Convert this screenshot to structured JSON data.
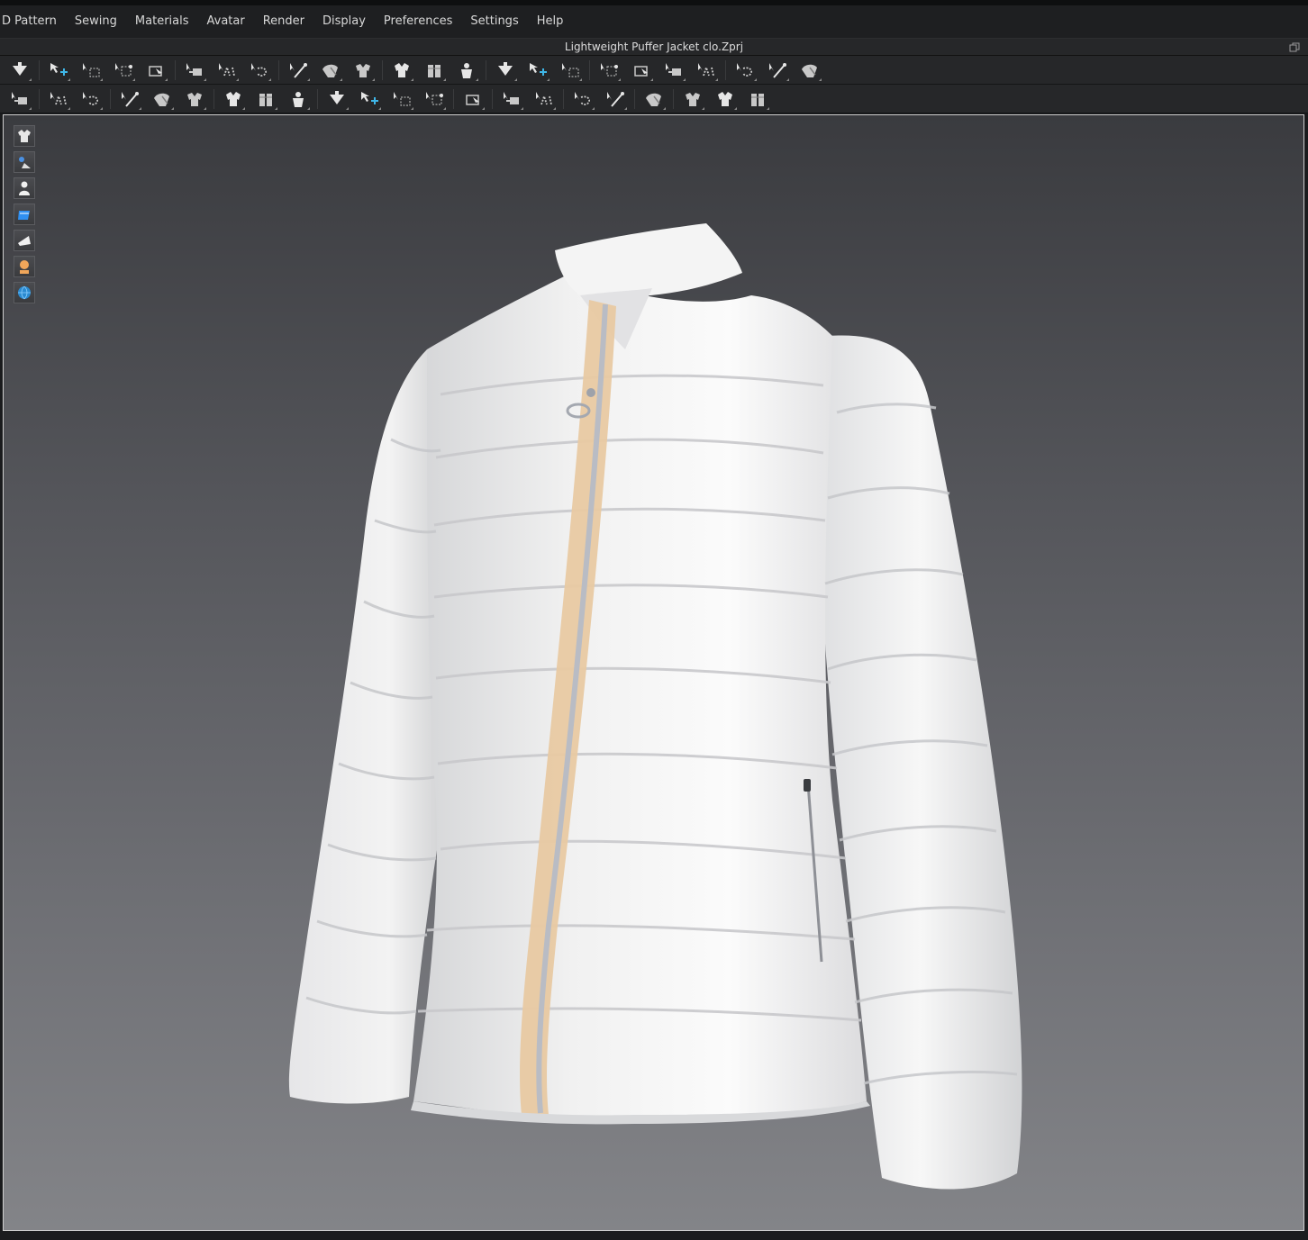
{
  "menu": {
    "items": [
      {
        "label": "D Pattern",
        "name": "menu-2d-pattern"
      },
      {
        "label": "Sewing",
        "name": "menu-sewing"
      },
      {
        "label": "Materials",
        "name": "menu-materials"
      },
      {
        "label": "Avatar",
        "name": "menu-avatar"
      },
      {
        "label": "Render",
        "name": "menu-render"
      },
      {
        "label": "Display",
        "name": "menu-display"
      },
      {
        "label": "Preferences",
        "name": "menu-preferences"
      },
      {
        "label": "Settings",
        "name": "menu-settings"
      },
      {
        "label": "Help",
        "name": "menu-help"
      }
    ]
  },
  "window": {
    "title": "Lightweight Puffer Jacket clo.Zprj",
    "restore_icon": "restore-window-icon"
  },
  "toolbar1": {
    "icons": [
      "simulation-icon",
      "|",
      "select-move-icon",
      "select-mesh-box-icon",
      "transform-pattern-icon",
      "fold-arrangement-icon",
      "|",
      "pin-icon",
      "pin-box-icon",
      "pin-lasso-icon",
      "|",
      "draw-line-icon",
      "tack-icon",
      "tack-on-avatar-icon",
      "|",
      "arrangement-points-icon",
      "show-arrangement-icon",
      "garment-fit-icon",
      "|",
      "strain-map-icon",
      "stress-map-icon",
      "fit-map-icon",
      "|",
      "layer-up-icon",
      "layer-down-icon",
      "clone-layer-icon",
      "shrinkwrap-icon",
      "|",
      "measure-circumference-icon",
      "tape-measure-icon",
      "ruler-icon"
    ]
  },
  "toolbar2": {
    "icons": [
      "avatar-pose-icon",
      "|",
      "edit-sewing-icon",
      "segment-sewing-icon",
      "|",
      "free-sewing-icon",
      "m-n-sewing-icon",
      "check-sewing-icon",
      "|",
      "edit-texture-icon",
      "graphic-icon",
      "trim-icon",
      "|",
      "button-icon",
      "select-button-icon",
      "buttonhole-icon",
      "zipper-icon",
      "|",
      "pipe-icon",
      "|",
      "topstitch-icon",
      "edit-topstitch-icon",
      "|",
      "puckering-icon",
      "edit-puckering-icon",
      "|",
      "fold-icon",
      "|",
      "tape-icon",
      "piping-icon",
      "shape-icon"
    ]
  },
  "side_toolbar": {
    "buttons": [
      {
        "name": "show-garment-icon",
        "color": "#e8e8e8"
      },
      {
        "name": "show-avatar-trim-icon",
        "color": "#4a90e2"
      },
      {
        "name": "show-avatar-icon",
        "color": "#f0f0f0"
      },
      {
        "name": "show-fabric-icon",
        "color": "#2f8ff0"
      },
      {
        "name": "show-pattern-icon",
        "color": "#f0f0f0"
      },
      {
        "name": "avatar-skin-icon",
        "color": "#f0a65a"
      },
      {
        "name": "environment-globe-icon",
        "color": "#2a8ad0"
      }
    ]
  },
  "viewport": {
    "subject": "white-puffer-jacket",
    "colors": {
      "jacket": "#f2f2f2",
      "zipper_tape": "#e8c9a2",
      "zipper_teeth": "#b9bcc4"
    }
  }
}
